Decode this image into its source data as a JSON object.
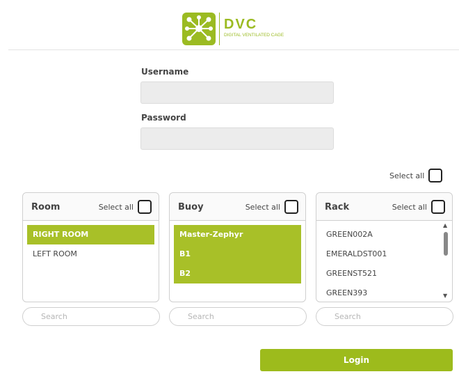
{
  "brand": {
    "logo_title": "DVC",
    "logo_subtitle": "DIGITAL VENTILATED CAGE",
    "accent_color": "#9bbb22"
  },
  "form": {
    "username_label": "Username",
    "username_value": "",
    "password_label": "Password",
    "password_value": ""
  },
  "global_select_all_label": "Select all",
  "panels": [
    {
      "title": "Room",
      "select_all_label": "Select all",
      "items": [
        {
          "label": "RIGHT ROOM",
          "selected": true
        },
        {
          "label": "LEFT ROOM",
          "selected": false
        }
      ],
      "search_placeholder": "Search"
    },
    {
      "title": "Buoy",
      "select_all_label": "Select all",
      "items": [
        {
          "label": "Master-Zephyr",
          "selected": true
        },
        {
          "label": "B1",
          "selected": true
        },
        {
          "label": "B2",
          "selected": true
        }
      ],
      "search_placeholder": "Search"
    },
    {
      "title": "Rack",
      "select_all_label": "Select all",
      "items": [
        {
          "label": "GREEN002A",
          "selected": false
        },
        {
          "label": "EMERALDST001",
          "selected": false
        },
        {
          "label": "GREENST521",
          "selected": false
        },
        {
          "label": "GREEN393",
          "selected": false
        }
      ],
      "search_placeholder": "Search"
    }
  ],
  "login_button_label": "Login"
}
